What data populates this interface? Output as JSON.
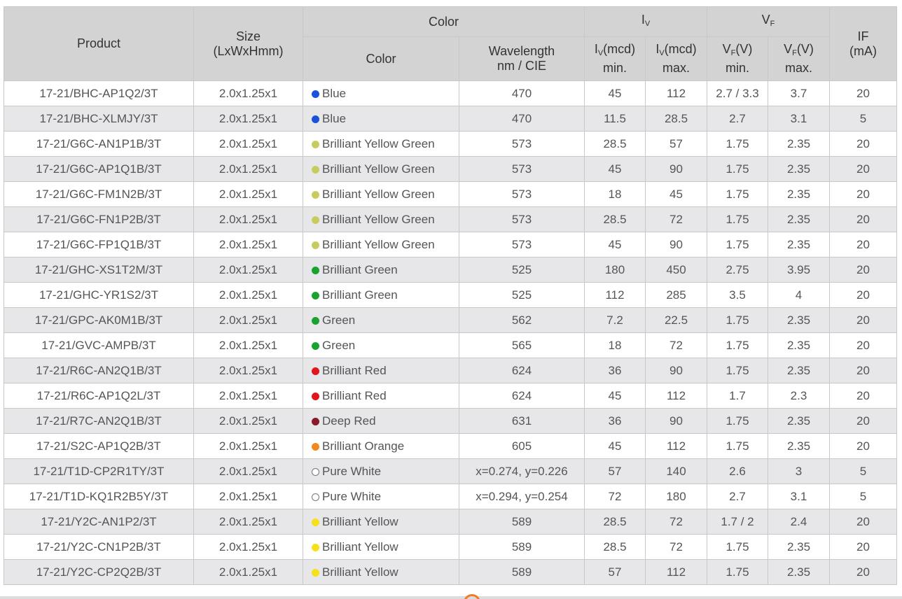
{
  "header": {
    "product": "Product",
    "size_line1": "Size",
    "size_line2": "(LxWxHmm)",
    "color_group": "Color",
    "color": "Color",
    "wavelength_line1": "Wavelength",
    "wavelength_line2": "nm / CIE",
    "iv_group": "I",
    "iv_group_sub": "V",
    "iv_min_a": "I",
    "iv_min_sub": "V",
    "iv_min_b": "(mcd)",
    "iv_min_c": "min.",
    "iv_max_a": "I",
    "iv_max_sub": "V",
    "iv_max_b": "(mcd)",
    "iv_max_c": "max.",
    "vf_group": "V",
    "vf_group_sub": "F",
    "vf_min_a": "V",
    "vf_min_sub": "F",
    "vf_min_b": "(V)",
    "vf_min_c": "min.",
    "vf_max_a": "V",
    "vf_max_sub": "F",
    "vf_max_b": "(V)",
    "vf_max_c": "max.",
    "if_line1": "IF",
    "if_line2": "(mA)"
  },
  "colors": {
    "blue": "#1a52d9",
    "yellow_green": "#c8cc60",
    "green": "#1aa22e",
    "red": "#e0161c",
    "deep_red": "#8a1a2a",
    "orange": "#f08a1e",
    "white": "#ffffff",
    "yellow": "#f5e01a"
  },
  "rows": [
    {
      "product": "17-21/BHC-AP1Q2/3T",
      "size": "2.0x1.25x1",
      "dot": "blue",
      "color": "Blue",
      "wavelength": "470",
      "iv_min": "45",
      "iv_max": "112",
      "vf_min": "2.7 / 3.3",
      "vf_max": "3.7",
      "if": "20"
    },
    {
      "product": "17-21/BHC-XLMJY/3T",
      "size": "2.0x1.25x1",
      "dot": "blue",
      "color": "Blue",
      "wavelength": "470",
      "iv_min": "11.5",
      "iv_max": "28.5",
      "vf_min": "2.7",
      "vf_max": "3.1",
      "if": "5"
    },
    {
      "product": "17-21/G6C-AN1P1B/3T",
      "size": "2.0x1.25x1",
      "dot": "yellow_green",
      "color": "Brilliant Yellow Green",
      "wavelength": "573",
      "iv_min": "28.5",
      "iv_max": "57",
      "vf_min": "1.75",
      "vf_max": "2.35",
      "if": "20"
    },
    {
      "product": "17-21/G6C-AP1Q1B/3T",
      "size": "2.0x1.25x1",
      "dot": "yellow_green",
      "color": "Brilliant Yellow Green",
      "wavelength": "573",
      "iv_min": "45",
      "iv_max": "90",
      "vf_min": "1.75",
      "vf_max": "2.35",
      "if": "20"
    },
    {
      "product": "17-21/G6C-FM1N2B/3T",
      "size": "2.0x1.25x1",
      "dot": "yellow_green",
      "color": "Brilliant Yellow Green",
      "wavelength": "573",
      "iv_min": "18",
      "iv_max": "45",
      "vf_min": "1.75",
      "vf_max": "2.35",
      "if": "20"
    },
    {
      "product": "17-21/G6C-FN1P2B/3T",
      "size": "2.0x1.25x1",
      "dot": "yellow_green",
      "color": "Brilliant Yellow Green",
      "wavelength": "573",
      "iv_min": "28.5",
      "iv_max": "72",
      "vf_min": "1.75",
      "vf_max": "2.35",
      "if": "20"
    },
    {
      "product": "17-21/G6C-FP1Q1B/3T",
      "size": "2.0x1.25x1",
      "dot": "yellow_green",
      "color": "Brilliant Yellow Green",
      "wavelength": "573",
      "iv_min": "45",
      "iv_max": "90",
      "vf_min": "1.75",
      "vf_max": "2.35",
      "if": "20"
    },
    {
      "product": "17-21/GHC-XS1T2M/3T",
      "size": "2.0x1.25x1",
      "dot": "green",
      "color": "Brilliant Green",
      "wavelength": "525",
      "iv_min": "180",
      "iv_max": "450",
      "vf_min": "2.75",
      "vf_max": "3.95",
      "if": "20"
    },
    {
      "product": "17-21/GHC-YR1S2/3T",
      "size": "2.0x1.25x1",
      "dot": "green",
      "color": "Brilliant Green",
      "wavelength": "525",
      "iv_min": "112",
      "iv_max": "285",
      "vf_min": "3.5",
      "vf_max": "4",
      "if": "20"
    },
    {
      "product": "17-21/GPC-AK0M1B/3T",
      "size": "2.0x1.25x1",
      "dot": "green",
      "color": "Green",
      "wavelength": "562",
      "iv_min": "7.2",
      "iv_max": "22.5",
      "vf_min": "1.75",
      "vf_max": "2.35",
      "if": "20"
    },
    {
      "product": "17-21/GVC-AMPB/3T",
      "size": "2.0x1.25x1",
      "dot": "green",
      "color": "Green",
      "wavelength": "565",
      "iv_min": "18",
      "iv_max": "72",
      "vf_min": "1.75",
      "vf_max": "2.35",
      "if": "20"
    },
    {
      "product": "17-21/R6C-AN2Q1B/3T",
      "size": "2.0x1.25x1",
      "dot": "red",
      "color": "Brilliant Red",
      "wavelength": "624",
      "iv_min": "36",
      "iv_max": "90",
      "vf_min": "1.75",
      "vf_max": "2.35",
      "if": "20"
    },
    {
      "product": "17-21/R6C-AP1Q2L/3T",
      "size": "2.0x1.25x1",
      "dot": "red",
      "color": "Brilliant Red",
      "wavelength": "624",
      "iv_min": "45",
      "iv_max": "112",
      "vf_min": "1.7",
      "vf_max": "2.3",
      "if": "20"
    },
    {
      "product": "17-21/R7C-AN2Q1B/3T",
      "size": "2.0x1.25x1",
      "dot": "deep_red",
      "color": "Deep Red",
      "wavelength": "631",
      "iv_min": "36",
      "iv_max": "90",
      "vf_min": "1.75",
      "vf_max": "2.35",
      "if": "20"
    },
    {
      "product": "17-21/S2C-AP1Q2B/3T",
      "size": "2.0x1.25x1",
      "dot": "orange",
      "color": "Brilliant Orange",
      "wavelength": "605",
      "iv_min": "45",
      "iv_max": "112",
      "vf_min": "1.75",
      "vf_max": "2.35",
      "if": "20"
    },
    {
      "product": "17-21/T1D-CP2R1TY/3T",
      "size": "2.0x1.25x1",
      "dot": "white",
      "color": "Pure White",
      "wavelength": "x=0.274, y=0.226",
      "iv_min": "57",
      "iv_max": "140",
      "vf_min": "2.6",
      "vf_max": "3",
      "if": "5"
    },
    {
      "product": "17-21/T1D-KQ1R2B5Y/3T",
      "size": "2.0x1.25x1",
      "dot": "white",
      "color": "Pure White",
      "wavelength": "x=0.294, y=0.254",
      "iv_min": "72",
      "iv_max": "180",
      "vf_min": "2.7",
      "vf_max": "3.1",
      "if": "5"
    },
    {
      "product": "17-21/Y2C-AN1P2/3T",
      "size": "2.0x1.25x1",
      "dot": "yellow",
      "color": "Brilliant Yellow",
      "wavelength": "589",
      "iv_min": "28.5",
      "iv_max": "72",
      "vf_min": "1.7 / 2",
      "vf_max": "2.4",
      "if": "20"
    },
    {
      "product": "17-21/Y2C-CN1P2B/3T",
      "size": "2.0x1.25x1",
      "dot": "yellow",
      "color": "Brilliant Yellow",
      "wavelength": "589",
      "iv_min": "28.5",
      "iv_max": "72",
      "vf_min": "1.75",
      "vf_max": "2.35",
      "if": "20"
    },
    {
      "product": "17-21/Y2C-CP2Q2B/3T",
      "size": "2.0x1.25x1",
      "dot": "yellow",
      "color": "Brilliant Yellow",
      "wavelength": "589",
      "iv_min": "57",
      "iv_max": "112",
      "vf_min": "1.75",
      "vf_max": "2.35",
      "if": "20"
    }
  ]
}
